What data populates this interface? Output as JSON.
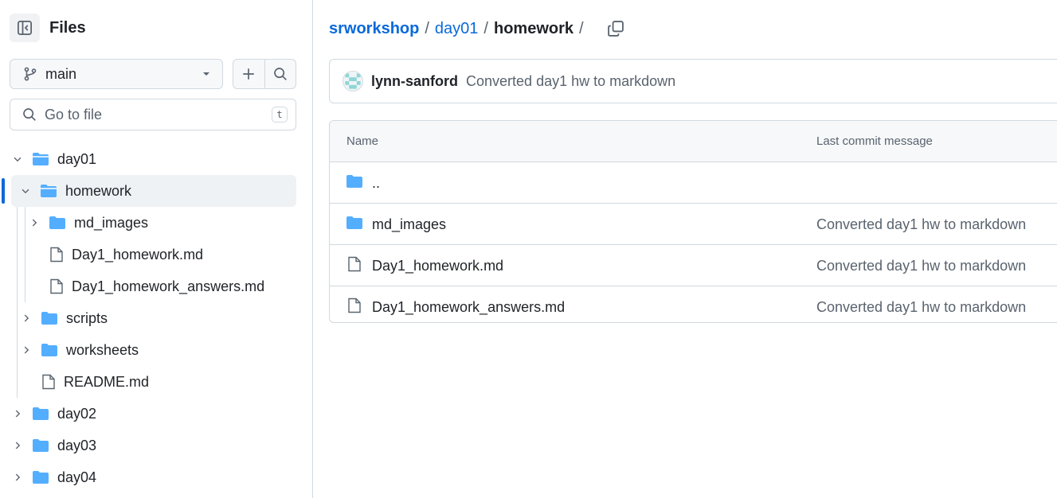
{
  "sidebar": {
    "title": "Files",
    "branch": "main",
    "search_placeholder": "Go to file",
    "search_shortcut": "t",
    "tree": [
      {
        "label": "day01",
        "type": "folder",
        "expanded": true
      },
      {
        "label": "homework",
        "type": "folder",
        "expanded": true,
        "selected": true
      },
      {
        "label": "md_images",
        "type": "folder",
        "expanded": false
      },
      {
        "label": "Day1_homework.md",
        "type": "file"
      },
      {
        "label": "Day1_homework_answers.md",
        "type": "file"
      },
      {
        "label": "scripts",
        "type": "folder",
        "expanded": false
      },
      {
        "label": "worksheets",
        "type": "folder",
        "expanded": false
      },
      {
        "label": "README.md",
        "type": "file"
      },
      {
        "label": "day02",
        "type": "folder",
        "expanded": false
      },
      {
        "label": "day03",
        "type": "folder",
        "expanded": false
      },
      {
        "label": "day04",
        "type": "folder",
        "expanded": false
      }
    ]
  },
  "breadcrumb": {
    "repo": "srworkshop",
    "parent": "day01",
    "current": "homework",
    "separator": "/"
  },
  "latest_commit": {
    "author": "lynn-sanford",
    "message": "Converted day1 hw to markdown"
  },
  "file_table": {
    "headers": {
      "name": "Name",
      "last_commit": "Last commit message"
    },
    "rows": [
      {
        "name": "..",
        "type": "folder",
        "message": ""
      },
      {
        "name": "md_images",
        "type": "folder",
        "message": "Converted day1 hw to markdown"
      },
      {
        "name": "Day1_homework.md",
        "type": "file",
        "message": "Converted day1 hw to markdown"
      },
      {
        "name": "Day1_homework_answers.md",
        "type": "file",
        "message": "Converted day1 hw to markdown"
      }
    ]
  },
  "colors": {
    "accent": "#0969da",
    "folder": "#54aeff",
    "border": "#d1d9e0",
    "muted": "#59636e"
  }
}
